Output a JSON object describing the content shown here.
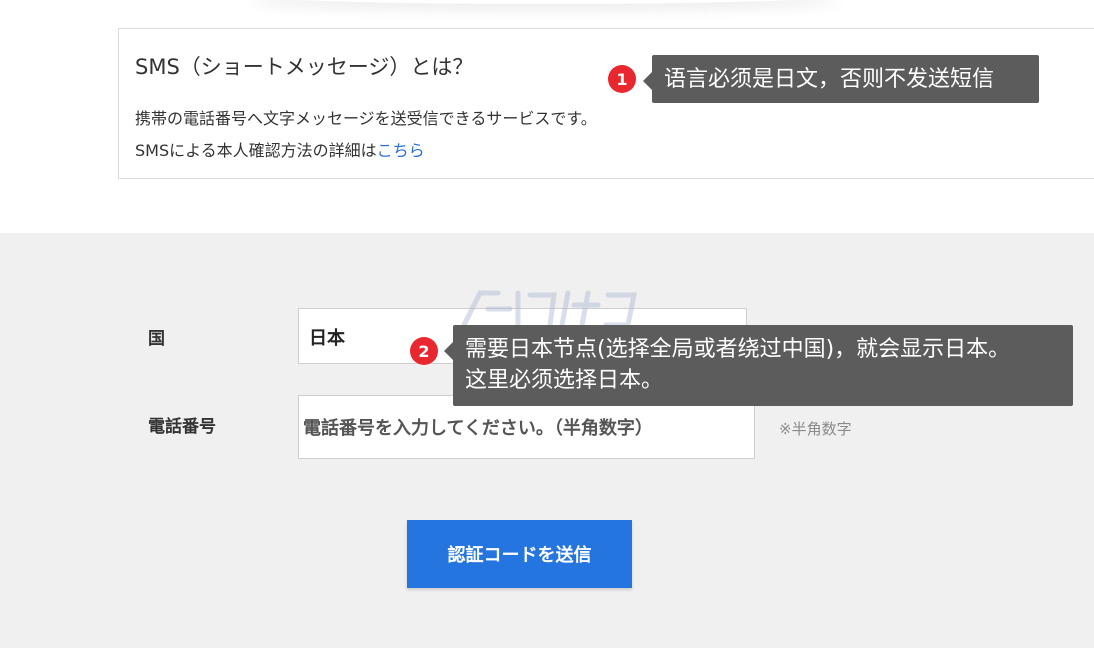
{
  "sms_info": {
    "title": "SMS（ショートメッセージ）とは？",
    "description": "携帯の電話番号へ文字メッセージを送受信できるサービスです。",
    "detail_prefix": "SMSによる本人確認方法の詳細は",
    "detail_link": "こちら"
  },
  "form": {
    "country_label": "国",
    "country_value": "日本",
    "phone_label": "電話番号",
    "phone_placeholder": "電話番号を入力してください。（半角数字）",
    "phone_note": "※半角数字",
    "submit_label": "認証コードを送信"
  },
  "annotations": [
    {
      "number": "1",
      "lines": [
        "语言必须是日文，否则不发送短信"
      ]
    },
    {
      "number": "2",
      "lines": [
        "需要日本节点(选择全局或者绕过中国)，就会显示日本。",
        "这里必须选择日本。"
      ]
    }
  ],
  "colors": {
    "accent_button": "#2575e0",
    "link": "#2a6fd6",
    "badge": "#e8272f",
    "tooltip_bg": "#5c5c5c",
    "form_background": "#f0f0f0"
  },
  "icons": {
    "country_dropdown": "chevron-down-icon"
  }
}
